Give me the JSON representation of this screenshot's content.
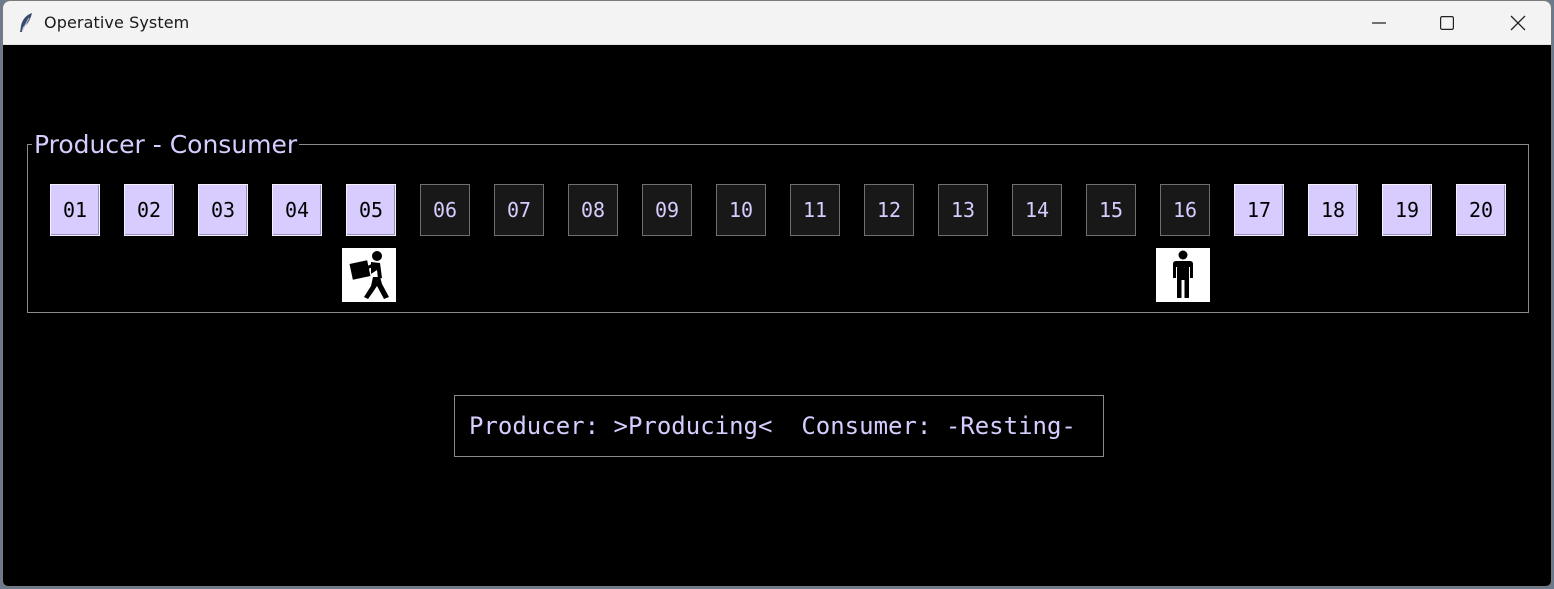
{
  "window": {
    "title": "Operative System",
    "app_icon": "feather-icon",
    "controls": [
      "minimize-icon",
      "maximize-icon",
      "close-icon"
    ]
  },
  "group": {
    "label": "Producer - Consumer"
  },
  "buffer": {
    "slots": [
      {
        "label": "01",
        "state": "full"
      },
      {
        "label": "02",
        "state": "full"
      },
      {
        "label": "03",
        "state": "full"
      },
      {
        "label": "04",
        "state": "full"
      },
      {
        "label": "05",
        "state": "full"
      },
      {
        "label": "06",
        "state": "empty"
      },
      {
        "label": "07",
        "state": "empty"
      },
      {
        "label": "08",
        "state": "empty"
      },
      {
        "label": "09",
        "state": "empty"
      },
      {
        "label": "10",
        "state": "empty"
      },
      {
        "label": "11",
        "state": "empty"
      },
      {
        "label": "12",
        "state": "empty"
      },
      {
        "label": "13",
        "state": "empty"
      },
      {
        "label": "14",
        "state": "empty"
      },
      {
        "label": "15",
        "state": "empty"
      },
      {
        "label": "16",
        "state": "empty"
      },
      {
        "label": "17",
        "state": "full"
      },
      {
        "label": "18",
        "state": "full"
      },
      {
        "label": "19",
        "state": "full"
      },
      {
        "label": "20",
        "state": "full"
      }
    ],
    "producer_slot": "05",
    "consumer_slot": "16",
    "producer_icon": "person-carrying-box-icon",
    "consumer_icon": "person-standing-icon"
  },
  "status": {
    "text": "Producer: >Producing<  Consumer: -Resting-"
  },
  "colors": {
    "background": "#000000",
    "accent": "#d8ccff",
    "empty_slot": "#181818",
    "border": "#8a8a8a"
  }
}
